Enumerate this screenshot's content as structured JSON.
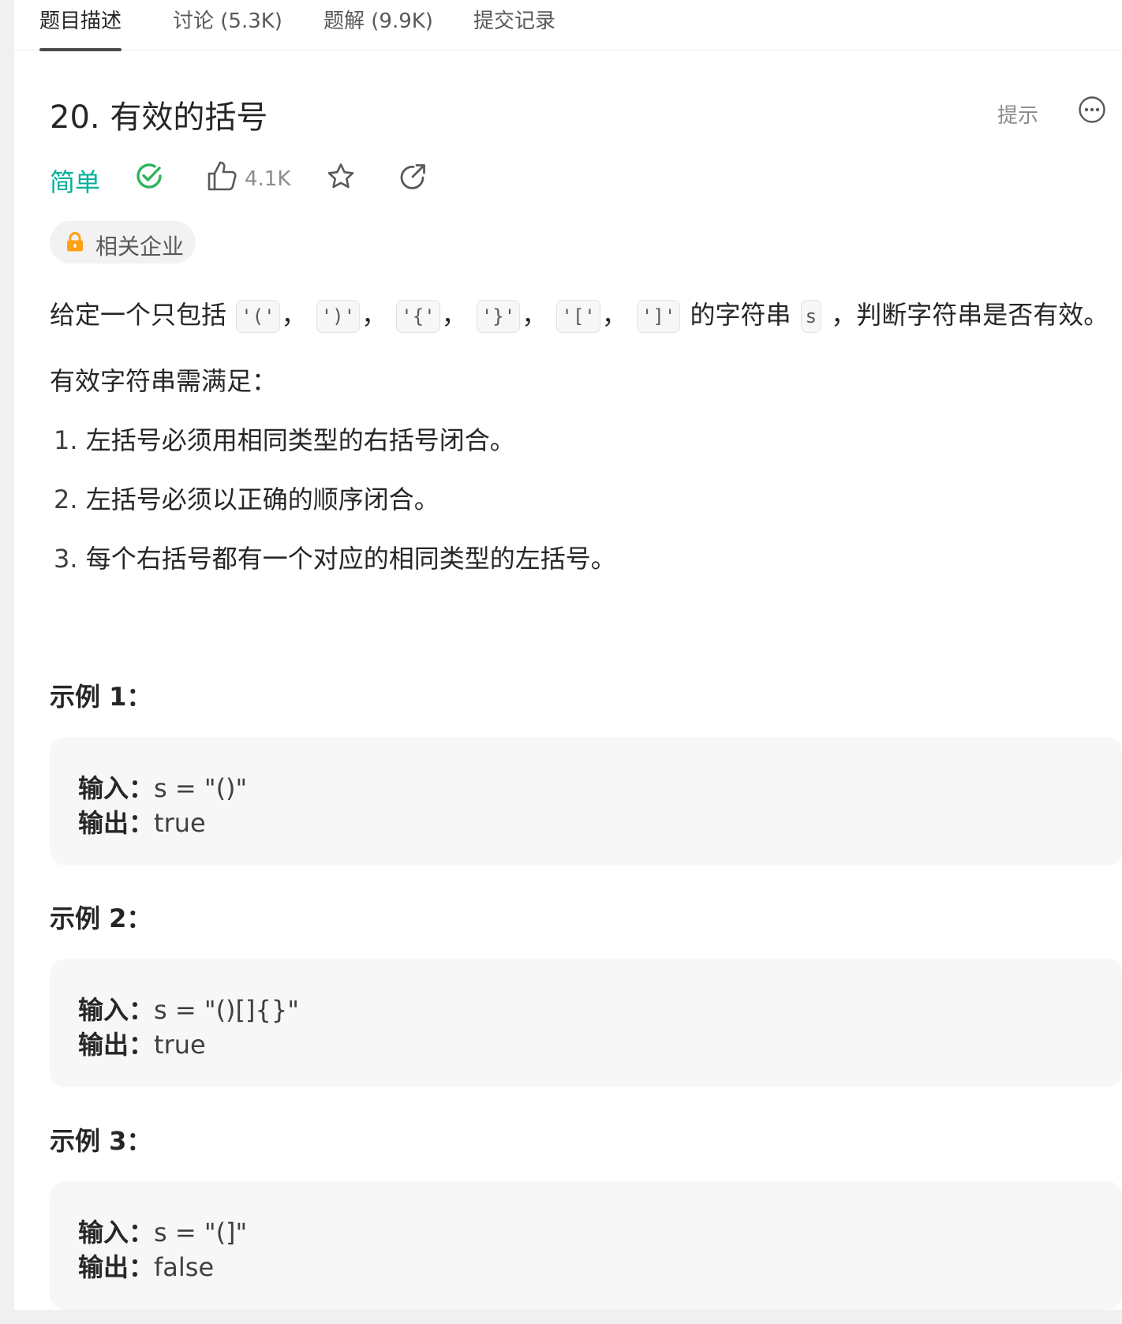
{
  "tabs": [
    {
      "label": "题目描述"
    },
    {
      "label": "讨论 (5.3K)"
    },
    {
      "label": "题解 (9.9K)"
    },
    {
      "label": "提交记录"
    }
  ],
  "problem": {
    "title": "20. 有效的括号",
    "hint_label": "提示",
    "difficulty": "简单",
    "like_count": "4.1K",
    "company_tag": "相关企业"
  },
  "description": {
    "intro_prefix": "给定一个只包括",
    "chars": [
      "'('",
      "')'",
      "'{'",
      "'}'",
      "'['",
      "']'"
    ],
    "sep": "，",
    "intro_mid": "的字符串",
    "var": "s",
    "intro_suffix": "，判断字符串是否有效。",
    "subtitle": "有效字符串需满足：",
    "rules": [
      {
        "num": "1.",
        "text": "左括号必须用相同类型的右括号闭合。"
      },
      {
        "num": "2.",
        "text": "左括号必须以正确的顺序闭合。"
      },
      {
        "num": "3.",
        "text": "每个右括号都有一个对应的相同类型的左括号。"
      }
    ]
  },
  "examples": [
    {
      "title": "示例 1：",
      "input_label": "输入：",
      "input": "s = \"()\"",
      "output_label": "输出：",
      "output": "true"
    },
    {
      "title": "示例 2：",
      "input_label": "输入：",
      "input": "s = \"()[]{}\"",
      "output_label": "输出：",
      "output": "true"
    },
    {
      "title": "示例 3：",
      "input_label": "输入：",
      "input": "s = \"(]\"",
      "output_label": "输出：",
      "output": "false"
    }
  ],
  "colors": {
    "easy": "#00af9b",
    "solved": "#2db55d",
    "lock": "#ffa116"
  }
}
